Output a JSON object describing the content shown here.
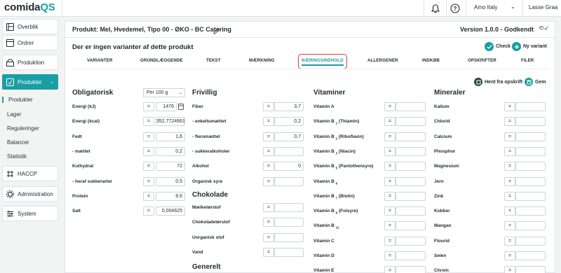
{
  "app": {
    "logo_main": "comida",
    "logo_accent": "QS"
  },
  "topbar": {
    "location": "Amo Italy",
    "user": "Lasse Graa"
  },
  "sidebar": {
    "items": [
      {
        "label": "Overblik",
        "icon": "overview-icon"
      },
      {
        "label": "Ordrer",
        "icon": "orders-icon"
      },
      {
        "label": "Produktion",
        "icon": "production-icon"
      },
      {
        "label": "Produkter",
        "icon": "products-icon",
        "active": true
      },
      {
        "label": "HACCP",
        "icon": "haccp-icon"
      },
      {
        "label": "Administration",
        "icon": "admin-icon"
      },
      {
        "label": "System",
        "icon": "system-icon"
      }
    ],
    "sub_items": [
      "Produkter",
      "Lager",
      "Reguleringer",
      "Balancer",
      "Statistik"
    ]
  },
  "product": {
    "title": "Produkt: Mel, Hvedemel, Tipo 00 - ØKO - BC Catering",
    "version": "Version 1.0.0 - Godkendt",
    "variants_note": "Der er ingen varianter af dette produkt",
    "check_label": "Check",
    "new_variant_label": "Ny variant"
  },
  "tabs": [
    "VARIANTER",
    "GRUNDLÆGGENDE",
    "TEKST",
    "MÆRKNING",
    "NÆRINGSINDHOLD",
    "ALLERGENER",
    "INDKØB",
    "OPSKRIFTER",
    "FILER"
  ],
  "active_tab": "NÆRINGSINDHOLD",
  "actions": {
    "fetch_recipe": "Hent fra opskrift",
    "save": "Gem"
  },
  "mandatory": {
    "title": "Obligatorisk",
    "per_select": "Per 100 g",
    "rows": [
      {
        "label": "Energi (kJ)",
        "value": "1476"
      },
      {
        "label": "Energi (kcal)",
        "value": "352,7724661"
      },
      {
        "label": "Fedt",
        "value": "1,6"
      },
      {
        "label": "- mættet",
        "value": "0,2"
      },
      {
        "label": "Kulhydrat",
        "value": "72"
      },
      {
        "label": "- heraf sukkerarter",
        "value": "0,5"
      },
      {
        "label": "Protein",
        "value": "9,6"
      },
      {
        "label": "Salt",
        "value": "0,004625"
      }
    ]
  },
  "optional": {
    "title": "Frivillig",
    "rows": [
      {
        "label": "Fiber",
        "value": "3,7"
      },
      {
        "label": "- enkeltumættet",
        "value": "0,2"
      },
      {
        "label": "- flerumættet",
        "value": "0,7"
      },
      {
        "label": "- sukkeralkoholer",
        "value": ""
      },
      {
        "label": "Alkohol",
        "value": "0"
      },
      {
        "label": "Organisk syre",
        "value": ""
      }
    ]
  },
  "chocolate": {
    "title": "Chokolade",
    "rows": [
      {
        "label": "Mælketørstof",
        "value": ""
      },
      {
        "label": "Chokoladetørstof",
        "value": ""
      },
      {
        "label": "Uorganisk stof",
        "value": ""
      },
      {
        "label": "Vand",
        "value": ""
      }
    ]
  },
  "general": {
    "title": "Generelt"
  },
  "vitamins": {
    "title": "Vitaminer",
    "rows": [
      {
        "label": "Vitamin A",
        "sub": "",
        "after": ""
      },
      {
        "label": "Vitamin B",
        "sub": "1",
        "after": " (Thiamin)"
      },
      {
        "label": "Vitamin B",
        "sub": "2",
        "after": " (Riboflavin)"
      },
      {
        "label": "Vitamin B",
        "sub": "3",
        "after": " (Niacin)"
      },
      {
        "label": "Vitamin B",
        "sub": "5",
        "after": " (Pantothensyre)"
      },
      {
        "label": "Vitamin B",
        "sub": "6",
        "after": ""
      },
      {
        "label": "Vitamin B",
        "sub": "7",
        "after": " (Biotin)"
      },
      {
        "label": "Vitamin B",
        "sub": "9",
        "after": " (Folsyre)"
      },
      {
        "label": "Vitamin B",
        "sub": "12",
        "after": ""
      },
      {
        "label": "Vitamin C",
        "sub": "",
        "after": ""
      },
      {
        "label": "Vitamin D",
        "sub": "",
        "after": ""
      },
      {
        "label": "Vitamin E",
        "sub": "",
        "after": ""
      }
    ]
  },
  "minerals": {
    "title": "Mineraler",
    "rows": [
      "Kalium",
      "Chlorid",
      "Calcium",
      "Phosphor",
      "Magnesium",
      "Jern",
      "Zink",
      "Kobber",
      "Mangan",
      "Flourid",
      "Selen",
      "Chrom"
    ]
  },
  "eq_symbol": "=",
  "colors": {
    "accent": "#1a9ea3",
    "highlight": "#e03a3a"
  }
}
